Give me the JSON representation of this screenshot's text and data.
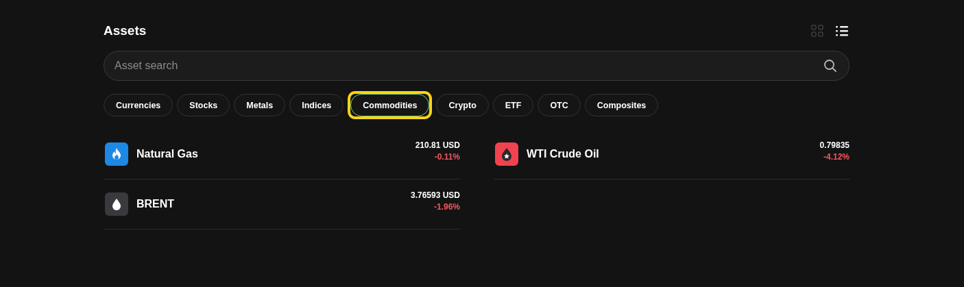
{
  "header": {
    "title": "Assets",
    "view_modes": [
      {
        "kind": "grid",
        "selected": false
      },
      {
        "kind": "list",
        "selected": true
      }
    ]
  },
  "search": {
    "placeholder": "Asset search"
  },
  "tabs": [
    {
      "label": "Currencies",
      "selected": false,
      "highlighted": false
    },
    {
      "label": "Stocks",
      "selected": false,
      "highlighted": false
    },
    {
      "label": "Metals",
      "selected": false,
      "highlighted": false
    },
    {
      "label": "Indices",
      "selected": false,
      "highlighted": false
    },
    {
      "label": "Commodities",
      "selected": true,
      "highlighted": true
    },
    {
      "label": "Crypto",
      "selected": false,
      "highlighted": false
    },
    {
      "label": "ETF",
      "selected": false,
      "highlighted": false
    },
    {
      "label": "OTC",
      "selected": false,
      "highlighted": false
    },
    {
      "label": "Composites",
      "selected": false,
      "highlighted": false
    }
  ],
  "assets": [
    {
      "kind": "flame",
      "color": "#1e88e5",
      "name": "Natural Gas",
      "price": "210.81 USD",
      "change": "-0.11%"
    },
    {
      "kind": "drop-star",
      "color": "#f0424f",
      "name": "WTI Crude Oil",
      "price": "0.79835",
      "change": "-4.12%"
    },
    {
      "kind": "drop",
      "color": "#3a3a3e",
      "name": "BRENT",
      "price": "3.76593 USD",
      "change": "-1.96%"
    }
  ]
}
